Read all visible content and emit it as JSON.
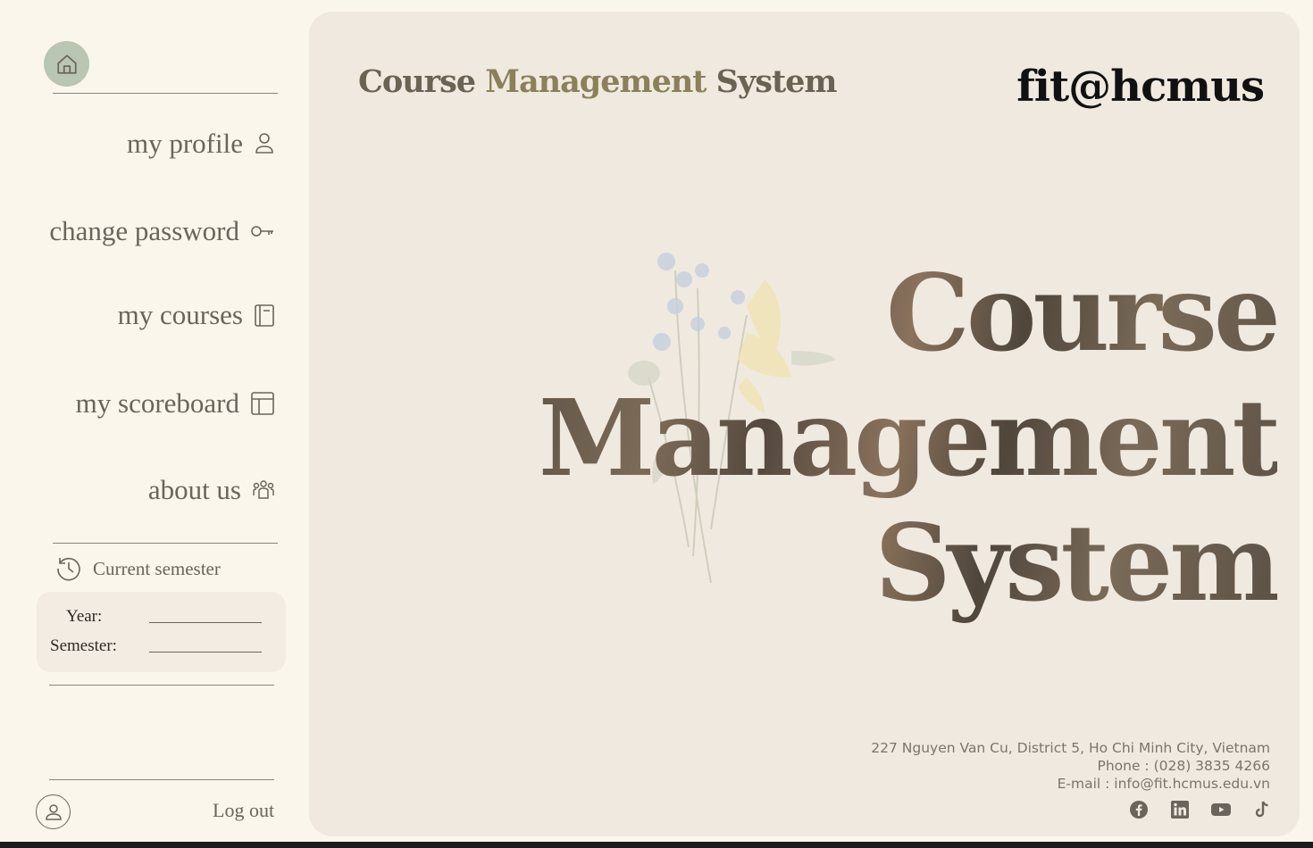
{
  "sidebar": {
    "nav": [
      {
        "label": "my profile",
        "icon": "user-icon"
      },
      {
        "label": "change password",
        "icon": "key-icon"
      },
      {
        "label": "my courses",
        "icon": "notebook-icon"
      },
      {
        "label": "my scoreboard",
        "icon": "table-icon"
      },
      {
        "label": "about us",
        "icon": "team-icon"
      }
    ],
    "semester": {
      "heading": "Current semester",
      "year_label": "Year:",
      "year_value": "",
      "semester_label": "Semester:",
      "semester_value": ""
    },
    "logout_label": "Log out"
  },
  "header": {
    "title_part1": "Course ",
    "title_part2": "Management",
    "title_part3": " System",
    "brand": "fit@hcmus"
  },
  "hero": {
    "line1": "Course",
    "line2": "Management",
    "line3": "System"
  },
  "contact": {
    "address": "227 Nguyen Van Cu, District 5, Ho Chi Minh City, Vietnam",
    "phone": "Phone : (028) 3835 4266",
    "email": "E-mail : info@fit.hcmus.edu.vn"
  },
  "socials": [
    "facebook-icon",
    "linkedin-icon",
    "youtube-icon",
    "tiktok-icon"
  ],
  "colors": {
    "page_bg": "#fbf6ec",
    "panel_bg": "#f0e9df",
    "accent_green": "#b9c6b3",
    "text_muted": "#6a655c"
  }
}
